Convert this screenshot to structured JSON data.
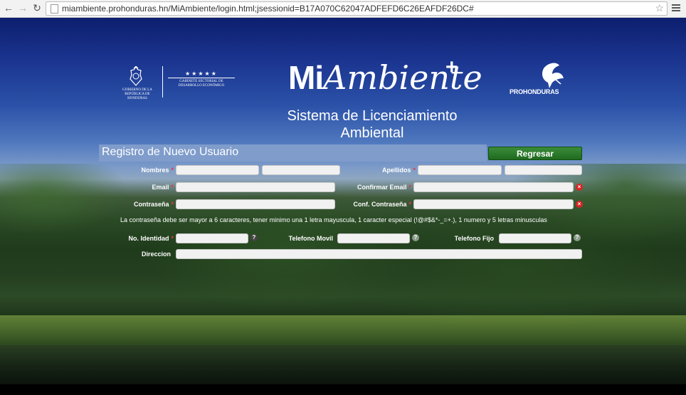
{
  "browser": {
    "url": "miambiente.prohonduras.hn/MiAmbiente/login.html;jsessionid=B17A070C62047ADFEFD6C26EAFDF26DC#",
    "back_icon": "back-arrow-icon",
    "forward_icon": "forward-arrow-icon",
    "reload_icon": "reload-icon"
  },
  "header": {
    "gov_logo_text": "GOBIERNO DE LA REPÚBLICA DE HONDURAS",
    "gov_stars": "★★★★★",
    "gov_cabinet": "GABINETE SECTORIAL DE DESARROLLO ECONÓMICO",
    "brand_mi": "Mi",
    "brand_ambiente": "Ambiente",
    "brand_plus": "+",
    "prohonduras": "PROHONDURAS",
    "subtitle_line1": "Sistema de Licenciamiento",
    "subtitle_line2": "Ambiental"
  },
  "form": {
    "title": "Registro de Nuevo Usuario",
    "back_button": "Regresar",
    "required_mark": "*",
    "labels": {
      "nombres": "Nombres",
      "apellidos": "Apellidos",
      "email": "Email",
      "confirmar_email": "Confirmar Email",
      "contrasena": "Contraseña",
      "conf_contrasena": "Conf. Contraseña",
      "identidad": "No. Identidad",
      "telefono_movil": "Telefono Movil",
      "telefono_fijo": "Telefono Fijo",
      "direccion": "Direccion"
    },
    "error_icon": "×",
    "help_icon": "?",
    "password_hint": "La contraseña debe ser mayor a 6 caracteres, tener minimo una 1 letra mayuscula, 1 caracter especial (!@#$&*-_=+.), 1 numero y 5 letras minusculas"
  },
  "colors": {
    "title_bar": "#7f9ccb",
    "button_green": "#2a7d2a",
    "required_red": "#e23b3b"
  }
}
